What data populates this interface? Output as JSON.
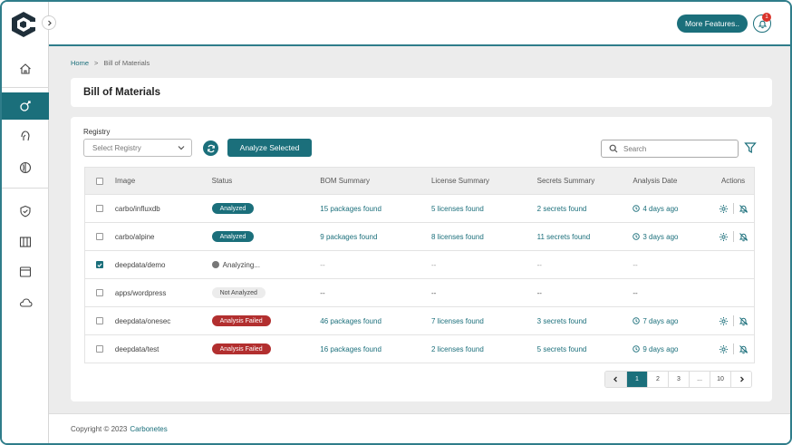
{
  "header": {
    "more_features": "More Features..",
    "notification_count": "1"
  },
  "breadcrumb": {
    "home": "Home",
    "separator": ">",
    "current": "Bill of Materials"
  },
  "page": {
    "title": "Bill of Materials"
  },
  "toolbar": {
    "registry_label": "Registry",
    "registry_placeholder": "Select Registry",
    "analyze_label": "Analyze Selected",
    "search_placeholder": "Search"
  },
  "table": {
    "headers": {
      "image": "Image",
      "status": "Status",
      "bom": "BOM Summary",
      "license": "License Summary",
      "secrets": "Secrets Summary",
      "date": "Analysis Date",
      "actions": "Actions"
    },
    "rows": [
      {
        "checked": false,
        "image": "carbo/influxdb",
        "status": "Analyzed",
        "status_type": "analyzed",
        "bom": "15 packages found",
        "license": "5 licenses found",
        "secrets": "2 secrets found",
        "date": "4 days ago",
        "has_actions": true
      },
      {
        "checked": false,
        "image": "carbo/alpine",
        "status": "Analyzed",
        "status_type": "analyzed",
        "bom": "9 packages found",
        "license": "8 licenses found",
        "secrets": "11 secrets found",
        "date": "3 days ago",
        "has_actions": true
      },
      {
        "checked": true,
        "image": "deepdata/demo",
        "status": "Analyzing...",
        "status_type": "analyzing",
        "bom": "--",
        "license": "--",
        "secrets": "--",
        "date": "--",
        "has_actions": false
      },
      {
        "checked": false,
        "image": "apps/wordpress",
        "status": "Not Analyzed",
        "status_type": "none",
        "bom": "--",
        "license": "--",
        "secrets": "--",
        "date": "--",
        "has_actions": false
      },
      {
        "checked": false,
        "image": "deepdata/onesec",
        "status": "Analysis Failed",
        "status_type": "failed",
        "bom": "46 packages found",
        "license": "7 licenses found",
        "secrets": "3 secrets found",
        "date": "7 days ago",
        "has_actions": true
      },
      {
        "checked": false,
        "image": "deepdata/test",
        "status": "Analysis Failed",
        "status_type": "failed",
        "bom": "16 packages found",
        "license": "2 licenses found",
        "secrets": "5 secrets found",
        "date": "9 days ago",
        "has_actions": true
      }
    ]
  },
  "pagination": {
    "pages": [
      "1",
      "2",
      "3",
      "...",
      "10"
    ],
    "current": "1"
  },
  "footer": {
    "copyright": "Copyright © 2023",
    "brand": "Carbonetes"
  },
  "colors": {
    "accent": "#1b6f7b",
    "danger": "#b22f2f",
    "badge": "#d9342b"
  }
}
